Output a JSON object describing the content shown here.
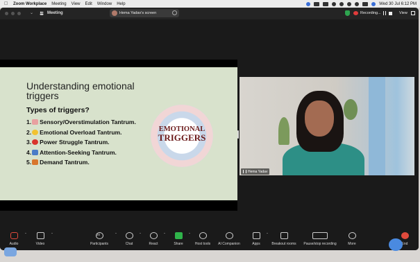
{
  "menubar": {
    "items": [
      "Zoom Workplace",
      "Meeting",
      "View",
      "Edit",
      "Window",
      "Help"
    ],
    "clock": "Wed 30 Jul  6:12 PM"
  },
  "titlebar": {
    "meeting_label": "Meeting",
    "screen_share_label": "Hema Yadav's screen",
    "recording_label": "Recording...",
    "view_label": "View"
  },
  "slide": {
    "title": "Understanding emotional triggers",
    "subtitle": "Types of triggers?",
    "items": [
      {
        "label": "1.",
        "text": "Sensory/Overstimulation Tantrum.",
        "emoji_color": "#e8a0a0"
      },
      {
        "label": "2.",
        "text": "Emotional Overload Tantrum.",
        "emoji_color": "#f2c230"
      },
      {
        "label": "3.",
        "text": "Power Struggle Tantrum.",
        "emoji_color": "#d9342b"
      },
      {
        "label": "4.",
        "text": "Attention-Seeking Tantrum.",
        "emoji_color": "#4a7cc7"
      },
      {
        "label": "5.",
        "text": "Demand  Tantrum.",
        "emoji_color": "#d8762c"
      }
    ],
    "image_text_line1": "EMOTIONAL",
    "image_text_line2": "TRIGGERS"
  },
  "video": {
    "participant_name": "Hema Yadav"
  },
  "toolbar": {
    "audio": "Audio",
    "video": "Video",
    "participants": "Participants",
    "participants_count": "30",
    "chat": "Chat",
    "react": "React",
    "share": "Share",
    "host_tools": "Host tools",
    "ai_companion": "AI Companion",
    "apps": "Apps",
    "breakout_rooms": "Breakout rooms",
    "pause_stop_recording": "Pause/stop recording",
    "more": "More",
    "end": "End"
  },
  "colors": {
    "slide_background": "#d8e2cc",
    "share_green": "#2fb34a",
    "end_red": "#e04a3c",
    "recording_red": "#e03b3b"
  }
}
